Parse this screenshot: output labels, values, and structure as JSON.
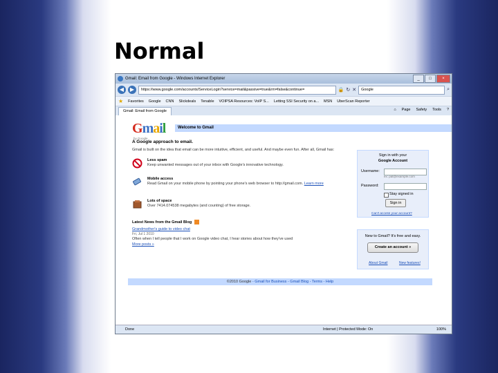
{
  "slide": {
    "title": "Normal"
  },
  "browser": {
    "window_title": "Gmail: Email from Google - Windows Internet Explorer",
    "url": "https://www.google.com/accounts/ServiceLogin?service=mail&passive=true&rm=false&continue=",
    "search_placeholder": "Google",
    "favorites": {
      "label": "Favorites",
      "items": [
        "Google",
        "CNN",
        "Slickdeals",
        "Tenable",
        "VOIPSA Resources: VoIP S...",
        "Letting SSI Security on a...",
        "MSN",
        "UberScan Reporter"
      ]
    },
    "tab": {
      "label": "Gmail: Email from Google"
    },
    "command_bar": {
      "page": "Page",
      "safety": "Safety",
      "tools": "Tools"
    },
    "status": {
      "left": "Done",
      "zone": "Internet | Protected Mode: On",
      "zoom": "100%"
    }
  },
  "gmail": {
    "logo_sub": "by Google",
    "welcome": "Welcome to Gmail",
    "tagline": "A Google approach to email.",
    "intro": "Gmail is built on the idea that email can be more intuitive, efficient, and useful. And maybe even fun. After all, Gmail has:",
    "features": [
      {
        "title": "Less spam",
        "desc": "Keep unwanted messages out of your inbox with Google's innovative technology."
      },
      {
        "title": "Mobile access",
        "desc": "Read Gmail on your mobile phone by pointing your phone's web browser to http://gmail.com.",
        "link": "Learn more"
      },
      {
        "title": "Lots of space",
        "desc": "Over 7414.074538 megabytes (and counting) of free storage."
      }
    ],
    "news": {
      "heading": "Latest News from the Gmail Blog",
      "link": "Grandmother's guide to video chat",
      "date": "Fri, Jul 1 2010",
      "text": "Often when I tell people that I work on Google video chat, I hear stories about how they've used",
      "more": "More posts »"
    },
    "signin": {
      "title": "Sign in with your",
      "title2": "Google Account",
      "username_label": "Username:",
      "hint": "ex: pat@example.com",
      "password_label": "Password:",
      "stay_signed_in": "Stay signed in",
      "button": "Sign in",
      "cant_access": "Can't access your account?"
    },
    "create": {
      "text": "New to Gmail? It's free and easy.",
      "button": "Create an account »",
      "about": "About Gmail",
      "new_features": "New features!"
    },
    "footer": {
      "copyright": "©2010 Google",
      "links": [
        "Gmail for Business",
        "Gmail Blog",
        "Terms",
        "Help"
      ]
    }
  }
}
